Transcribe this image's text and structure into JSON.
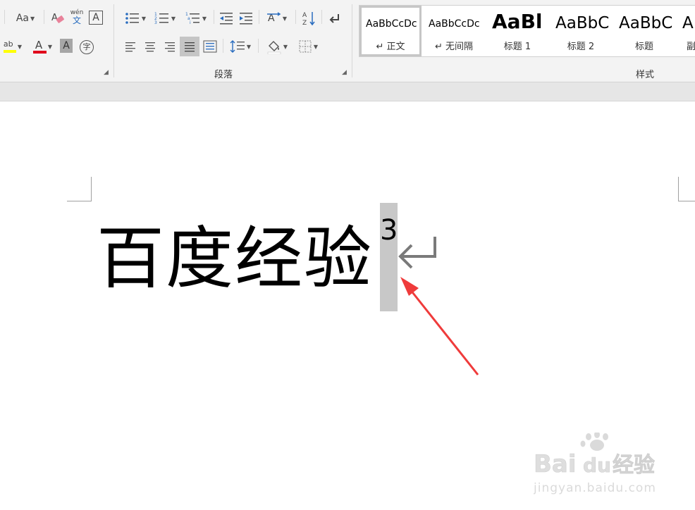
{
  "ribbon": {
    "font_group": {
      "change_case_label": "Aa",
      "phonetic_label_top": "wén",
      "phonetic_label_bottom": "文",
      "char_border_label": "A",
      "font_color_label": "A",
      "char_shading_label": "A",
      "enclose_char_label": "字",
      "highlight_label": "ab",
      "highlight_color": "#ffff00",
      "font_color": "#e0001b"
    },
    "paragraph_group": {
      "label": "段落"
    },
    "styles_group": {
      "label": "样式",
      "items": [
        {
          "sample": "AaBbCcDc",
          "name": "↵ 正文"
        },
        {
          "sample": "AaBbCcDc",
          "name": "↵ 无间隔"
        },
        {
          "sample": "AaBl",
          "name": "标题 1"
        },
        {
          "sample": "AaBbC",
          "name": "标题 2"
        },
        {
          "sample": "AaBbC",
          "name": "标题"
        },
        {
          "sample": "A",
          "name": "副"
        }
      ]
    }
  },
  "document": {
    "main_text": "百度经验",
    "superscript": "3",
    "selection_color": "#c8c8c8",
    "pilcrow_icon": "paragraph-return-icon",
    "arrow_color": "#ef3b3b"
  },
  "watermark": {
    "brand": "Bai",
    "brand_du": "du",
    "brand_cn": "经验",
    "url": "jingyan.baidu.com"
  }
}
